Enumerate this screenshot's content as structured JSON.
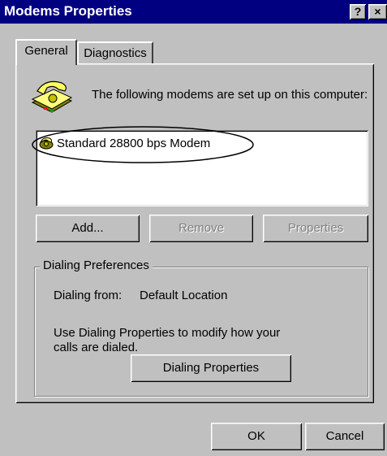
{
  "window": {
    "title": "Modems Properties",
    "help_button": "?",
    "close_button": "×"
  },
  "tabs": [
    {
      "label": "General",
      "active": true
    },
    {
      "label": "Diagnostics",
      "active": false
    }
  ],
  "intro_text": "The following modems are set up on this computer:",
  "modems": [
    {
      "name": "Standard 28800 bps Modem",
      "icon": "modem-icon",
      "highlighted": true
    }
  ],
  "buttons": {
    "add": "Add...",
    "remove": "Remove",
    "properties": "Properties"
  },
  "dialing": {
    "group_label": "Dialing Preferences",
    "from_label": "Dialing from:",
    "from_value": "Default Location",
    "help_text": "Use Dialing Properties to modify how your calls are dialed.",
    "button": "Dialing Properties"
  },
  "footer": {
    "ok": "OK",
    "cancel": "Cancel"
  },
  "icons": {
    "phone": "telephone-icon",
    "modem": "modem-icon"
  },
  "colors": {
    "titlebar": "#000080",
    "face": "#c0c0c0",
    "annotation": "#000000"
  }
}
